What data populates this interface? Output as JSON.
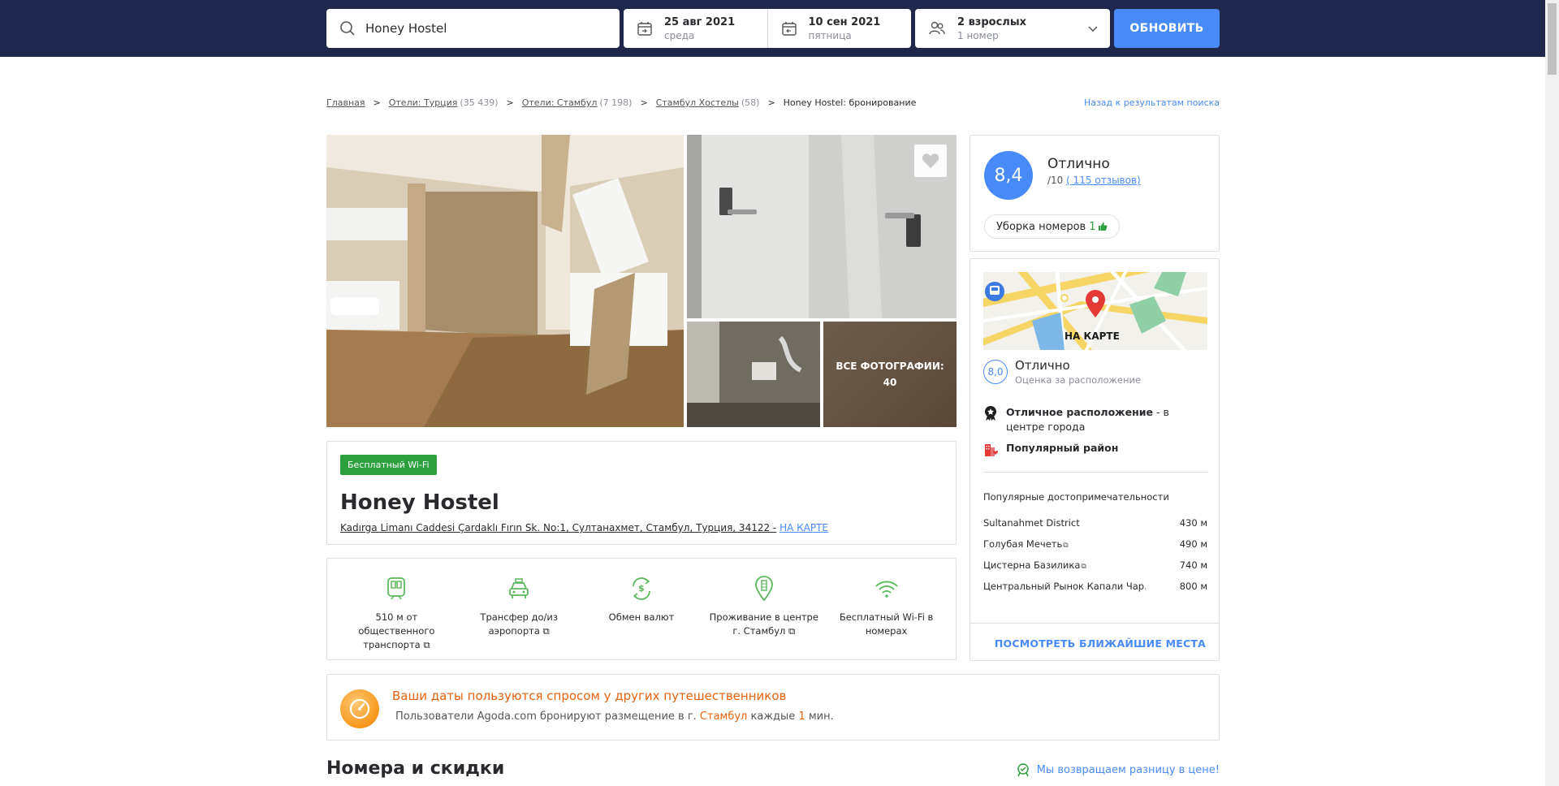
{
  "header": {
    "search_value": "Honey Hostel",
    "checkin_date": "25 авг 2021",
    "checkin_day": "среда",
    "checkout_date": "10 сен 2021",
    "checkout_day": "пятница",
    "guests": "2 взрослых",
    "rooms": "1 номер",
    "update_label": "ОБНОВИТЬ"
  },
  "breadcrumb": {
    "items": [
      {
        "label": "Главная",
        "count": ""
      },
      {
        "label": "Отели: Турция",
        "count": "(35 439)"
      },
      {
        "label": "Отели: Стамбул",
        "count": "(7 198)"
      },
      {
        "label": "Стамбул Хостелы",
        "count": "(58)"
      }
    ],
    "separator": ">",
    "current": "Honey Hostel: бронирование",
    "back_label": "Назад к результатам поиска"
  },
  "gallery": {
    "all_photos_label": "ВСЕ ФОТОГРАФИИ:",
    "all_photos_count": "40"
  },
  "hotel": {
    "badge": "Бесплатный Wi-Fi",
    "name": "Honey Hostel",
    "address": "Kadırga Limanı Caddesi Çardaklı Fırın Sk. No:1, Султанахмет, Стамбул, Турция, 34122 -",
    "map_link": "НА КАРТЕ"
  },
  "features": [
    {
      "icon": "train-icon",
      "label": "510 м от общественного транспорта"
    },
    {
      "icon": "taxi-icon",
      "label": "Трансфер до/из аэропорта"
    },
    {
      "icon": "currency-exchange-icon",
      "label": "Обмен валют"
    },
    {
      "icon": "location-pin-icon",
      "label": "Проживание в центре г. Стамбул"
    },
    {
      "icon": "wifi-icon",
      "label": "Бесплатный Wi-Fi в номерах"
    }
  ],
  "rating": {
    "score": "8,4",
    "word": "Отлично",
    "out_of": "/10",
    "reviews": "( 115 отзывов)",
    "cleanliness_label": "Уборка номеров",
    "cleanliness_count": "1"
  },
  "location": {
    "map_label": "НА КАРТЕ",
    "score": "8,0",
    "word": "Отлично",
    "sub": "Оценка за расположение",
    "highlight1_bold": "Отличное расположение",
    "highlight1_rest": " - в центре города",
    "highlight2": "Популярный район",
    "pois_title": "Популярные достопримечательности",
    "pois": [
      {
        "name": "Sultanahmet District",
        "distance": "430 м",
        "ext": false
      },
      {
        "name": "Голубая Мечеть",
        "distance": "490 м",
        "ext": true
      },
      {
        "name": "Цистерна Базилика",
        "distance": "740 м",
        "ext": true
      },
      {
        "name": "Центральный Рынок Капали Чар...",
        "distance": "800 м",
        "ext": false
      }
    ],
    "nearby_label": "ПОСМОТРЕТЬ БЛИЖАЙШИЕ МЕСТА"
  },
  "demand": {
    "title": "Ваши даты пользуются спросом у других путешественников",
    "text_1": "Пользователи Agoda.com бронируют размещение в г.",
    "city": "Стамбул",
    "text_2": "каждые",
    "minutes": "1",
    "text_3": "мин."
  },
  "rooms": {
    "title": "Номера и скидки",
    "price_guarantee": "Мы возвращаем разницу в цене!"
  },
  "colors": {
    "header_bg": "#20274d",
    "accent_blue": "#488bf8",
    "badge_green": "#2d9f3c",
    "feature_green": "#5cb85c",
    "demand_orange": "#e8620c"
  }
}
